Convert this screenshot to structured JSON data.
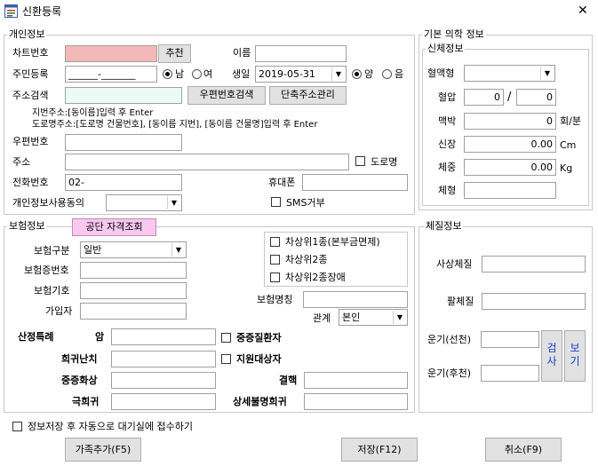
{
  "window": {
    "title": "신환등록",
    "close_glyph": "✕",
    "icon": "app-form-icon"
  },
  "personal": {
    "group_title": "개인정보",
    "chart_no_label": "차트번호",
    "chart_no_value": "",
    "recommend_button": "추천",
    "name_label": "이름",
    "name_value": "",
    "rrn_label": "주민등록",
    "rrn_value": "______-_______",
    "sex_male": "남",
    "sex_female": "여",
    "birth_label": "생일",
    "birth_value": "2019-05-31",
    "cal_solar": "양",
    "cal_lunar": "음",
    "addr_search_label": "주소검색",
    "addr_search_value": "",
    "zip_search_button": "우편번호검색",
    "short_addr_button": "단축주소관리",
    "hint1": "지번주소:[동이름]입력 후 Enter",
    "hint2": "도로명주소:[도로명 건물번호], [동이름 지번], [동이름 건물명]입력 후 Enter",
    "zip_label": "우편번호",
    "zip_value": "",
    "addr_label": "주소",
    "addr_value": "",
    "road_name_label": "도로명",
    "phone_label": "전화번호",
    "phone_value": "02-",
    "mobile_label": "휴대폰",
    "mobile_value": "",
    "consent_label": "개인정보사용동의",
    "consent_value": "",
    "sms_refuse_label": "SMS거부"
  },
  "insurance": {
    "group_title": "보험정보",
    "qualify_button": "공단 자격조회",
    "type_label": "보험구분",
    "type_value": "일반",
    "cert_no_label": "보험증번호",
    "cert_no_value": "",
    "symbol_label": "보험기호",
    "symbol_value": "",
    "subscriber_label": "가입자",
    "subscriber_value": "",
    "upper1_label": "차상위1종(본부금면제)",
    "upper2_label": "차상위2종",
    "upper2_disabled_label": "차상위2종장애",
    "insured_name_label": "보험명칭",
    "insured_name_value": "",
    "relation_label": "관계",
    "relation_value": "본인",
    "special_label": "산정특례",
    "cancer_label": "암",
    "cancer_value": "",
    "severe_label": "중증질환자",
    "rare_label": "희귀난치",
    "rare_value": "",
    "support_label": "지원대상자",
    "burn_label": "중증화상",
    "burn_value": "",
    "tb_label": "결핵",
    "tb_value": "",
    "ultra_rare_label": "극희귀",
    "ultra_rare_value": "",
    "unknown_rare_label": "상세불명희귀",
    "unknown_rare_value": ""
  },
  "medical": {
    "outer_title": "기본 의학 정보",
    "body_title": "신체정보",
    "blood_label": "혈액형",
    "blood_value": "",
    "bp_label": "혈압",
    "bp_sys": "0",
    "bp_sep": "/",
    "bp_dia": "0",
    "pulse_label": "맥박",
    "pulse_value": "0",
    "pulse_unit": "회/분",
    "height_label": "신장",
    "height_value": "0.00",
    "height_unit": "Cm",
    "weight_label": "체중",
    "weight_value": "0.00",
    "weight_unit": "Kg",
    "shape_label": "체형",
    "shape_value": ""
  },
  "constitution": {
    "group_title": "체질정보",
    "sasang_label": "사상체질",
    "sasang_value": "",
    "eight_label": "팔체질",
    "eight_value": "",
    "fortune_front_label": "운기(선천)",
    "fortune_front_value": "",
    "fortune_back_label": "운기(후천)",
    "fortune_back_value": "",
    "calc_button": "검사",
    "view_button": "보기"
  },
  "footer": {
    "auto_wait_label": "정보저장 후 자동으로 대기실에 접수하기",
    "add_family_button": "가족추가(F5)",
    "save_button": "저장(F12)",
    "cancel_button": "취소(F9)"
  }
}
